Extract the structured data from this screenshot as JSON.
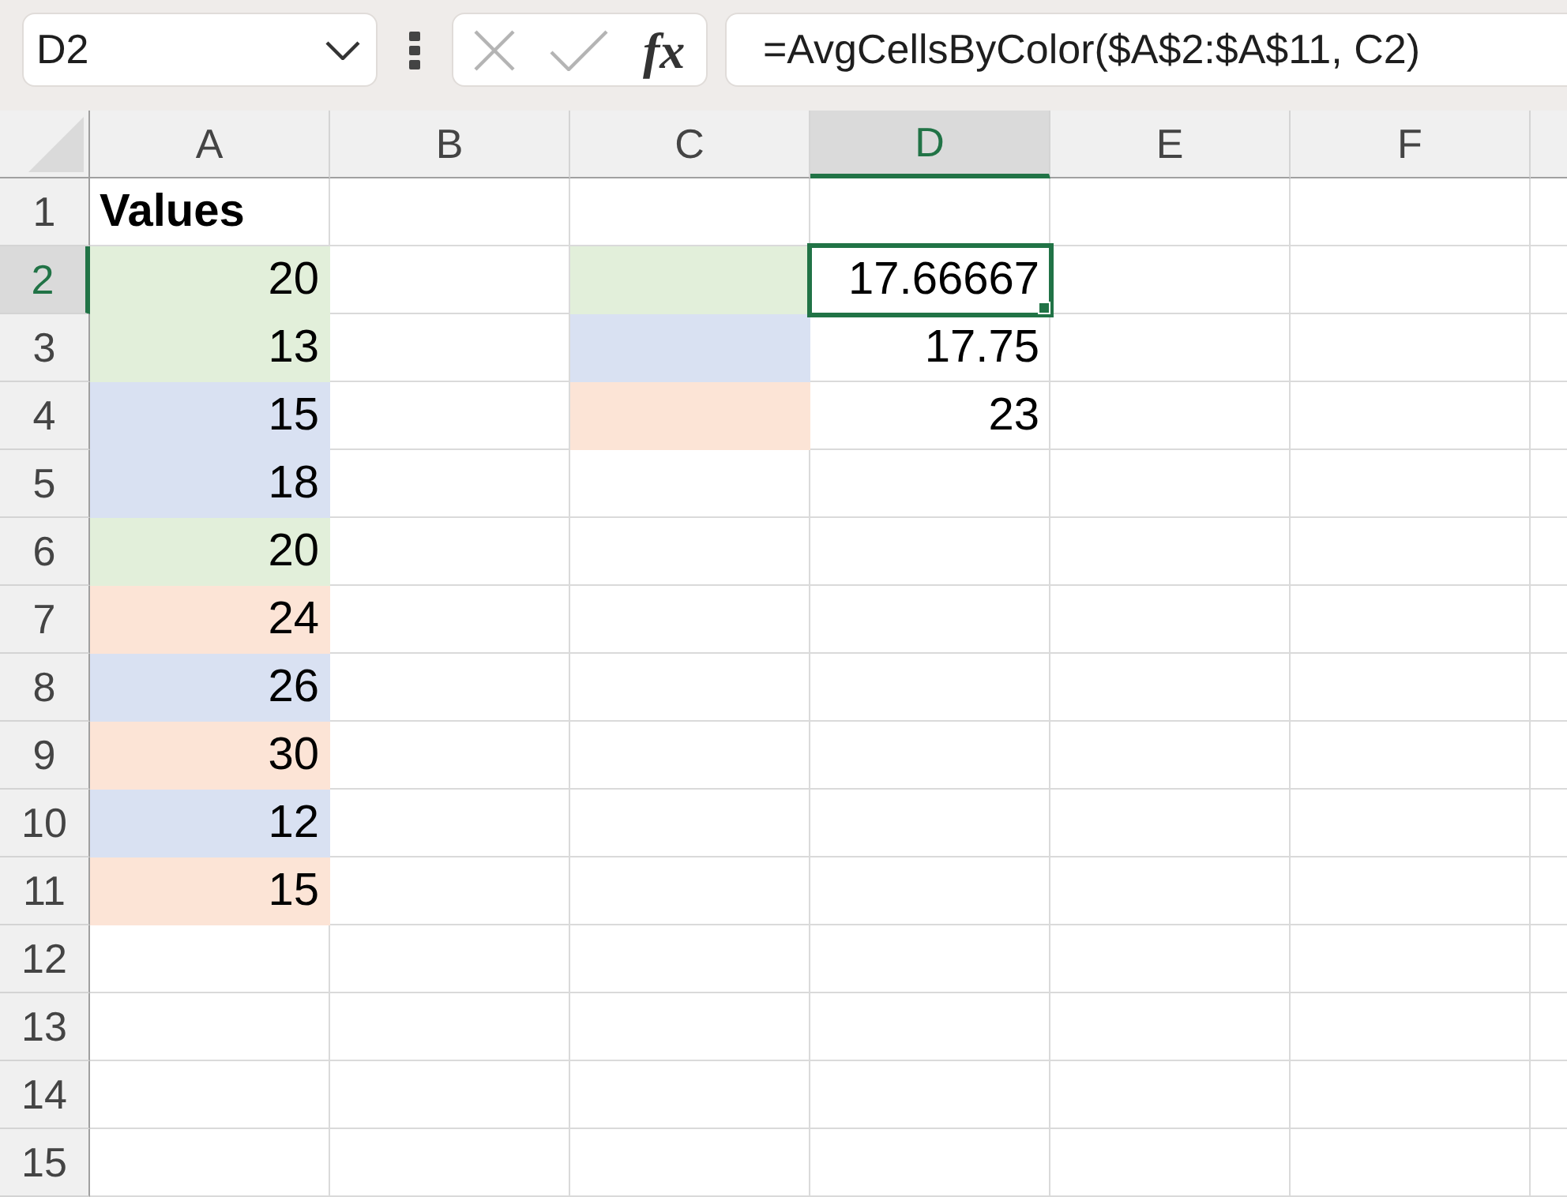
{
  "formula_bar": {
    "name_box": "D2",
    "buttons": [
      {
        "kind": "cancel",
        "disabled": true
      },
      {
        "kind": "enter",
        "disabled": true
      },
      {
        "kind": "function",
        "label": "fx",
        "disabled": false
      }
    ],
    "formula": "=AvgCellsByColor($A$2:$A$11, C2)"
  },
  "columns": [
    {
      "label": "A",
      "active": false
    },
    {
      "label": "B",
      "active": false
    },
    {
      "label": "C",
      "active": false
    },
    {
      "label": "D",
      "active": true
    },
    {
      "label": "E",
      "active": false
    },
    {
      "label": "F",
      "active": false
    }
  ],
  "rows": [
    {
      "label": "1",
      "active": false,
      "cells": [
        {
          "value": "Values",
          "kind": "text",
          "bold": true,
          "selected": false
        },
        {
          "selected": false
        },
        {
          "selected": false
        },
        {
          "selected": false
        },
        {
          "selected": false
        },
        {
          "selected": false
        }
      ]
    },
    {
      "label": "2",
      "active": true,
      "cells": [
        {
          "value": "20",
          "kind": "number",
          "color": "#e2efda",
          "selected": false
        },
        {
          "selected": false
        },
        {
          "color": "#e2efda",
          "selected": false
        },
        {
          "value": "17.66667",
          "kind": "number",
          "selected": true
        },
        {
          "selected": false
        },
        {
          "selected": false
        }
      ]
    },
    {
      "label": "3",
      "active": false,
      "cells": [
        {
          "value": "13",
          "kind": "number",
          "color": "#e2efda",
          "selected": false
        },
        {
          "selected": false
        },
        {
          "color": "#d9e1f2",
          "selected": false
        },
        {
          "value": "17.75",
          "kind": "number",
          "selected": false
        },
        {
          "selected": false
        },
        {
          "selected": false
        }
      ]
    },
    {
      "label": "4",
      "active": false,
      "cells": [
        {
          "value": "15",
          "kind": "number",
          "color": "#d9e1f2",
          "selected": false
        },
        {
          "selected": false
        },
        {
          "color": "#fce4d6",
          "selected": false
        },
        {
          "value": "23",
          "kind": "number",
          "selected": false
        },
        {
          "selected": false
        },
        {
          "selected": false
        }
      ]
    },
    {
      "label": "5",
      "active": false,
      "cells": [
        {
          "value": "18",
          "kind": "number",
          "color": "#d9e1f2",
          "selected": false
        },
        {
          "selected": false
        },
        {
          "selected": false
        },
        {
          "selected": false
        },
        {
          "selected": false
        },
        {
          "selected": false
        }
      ]
    },
    {
      "label": "6",
      "active": false,
      "cells": [
        {
          "value": "20",
          "kind": "number",
          "color": "#e2efda",
          "selected": false
        },
        {
          "selected": false
        },
        {
          "selected": false
        },
        {
          "selected": false
        },
        {
          "selected": false
        },
        {
          "selected": false
        }
      ]
    },
    {
      "label": "7",
      "active": false,
      "cells": [
        {
          "value": "24",
          "kind": "number",
          "color": "#fce4d6",
          "selected": false
        },
        {
          "selected": false
        },
        {
          "selected": false
        },
        {
          "selected": false
        },
        {
          "selected": false
        },
        {
          "selected": false
        }
      ]
    },
    {
      "label": "8",
      "active": false,
      "cells": [
        {
          "value": "26",
          "kind": "number",
          "color": "#d9e1f2",
          "selected": false
        },
        {
          "selected": false
        },
        {
          "selected": false
        },
        {
          "selected": false
        },
        {
          "selected": false
        },
        {
          "selected": false
        }
      ]
    },
    {
      "label": "9",
      "active": false,
      "cells": [
        {
          "value": "30",
          "kind": "number",
          "color": "#fce4d6",
          "selected": false
        },
        {
          "selected": false
        },
        {
          "selected": false
        },
        {
          "selected": false
        },
        {
          "selected": false
        },
        {
          "selected": false
        }
      ]
    },
    {
      "label": "10",
      "active": false,
      "cells": [
        {
          "value": "12",
          "kind": "number",
          "color": "#d9e1f2",
          "selected": false
        },
        {
          "selected": false
        },
        {
          "selected": false
        },
        {
          "selected": false
        },
        {
          "selected": false
        },
        {
          "selected": false
        }
      ]
    },
    {
      "label": "11",
      "active": false,
      "cells": [
        {
          "value": "15",
          "kind": "number",
          "color": "#fce4d6",
          "selected": false
        },
        {
          "selected": false
        },
        {
          "selected": false
        },
        {
          "selected": false
        },
        {
          "selected": false
        },
        {
          "selected": false
        }
      ]
    },
    {
      "label": "12",
      "active": false,
      "cells": [
        {
          "selected": false
        },
        {
          "selected": false
        },
        {
          "selected": false
        },
        {
          "selected": false
        },
        {
          "selected": false
        },
        {
          "selected": false
        }
      ]
    },
    {
      "label": "13",
      "active": false,
      "cells": [
        {
          "selected": false
        },
        {
          "selected": false
        },
        {
          "selected": false
        },
        {
          "selected": false
        },
        {
          "selected": false
        },
        {
          "selected": false
        }
      ]
    },
    {
      "label": "14",
      "active": false,
      "cells": [
        {
          "selected": false
        },
        {
          "selected": false
        },
        {
          "selected": false
        },
        {
          "selected": false
        },
        {
          "selected": false
        },
        {
          "selected": false
        }
      ]
    },
    {
      "label": "15",
      "active": false,
      "cells": [
        {
          "selected": false
        },
        {
          "selected": false
        },
        {
          "selected": false
        },
        {
          "selected": false
        },
        {
          "selected": false
        },
        {
          "selected": false
        }
      ]
    }
  ]
}
